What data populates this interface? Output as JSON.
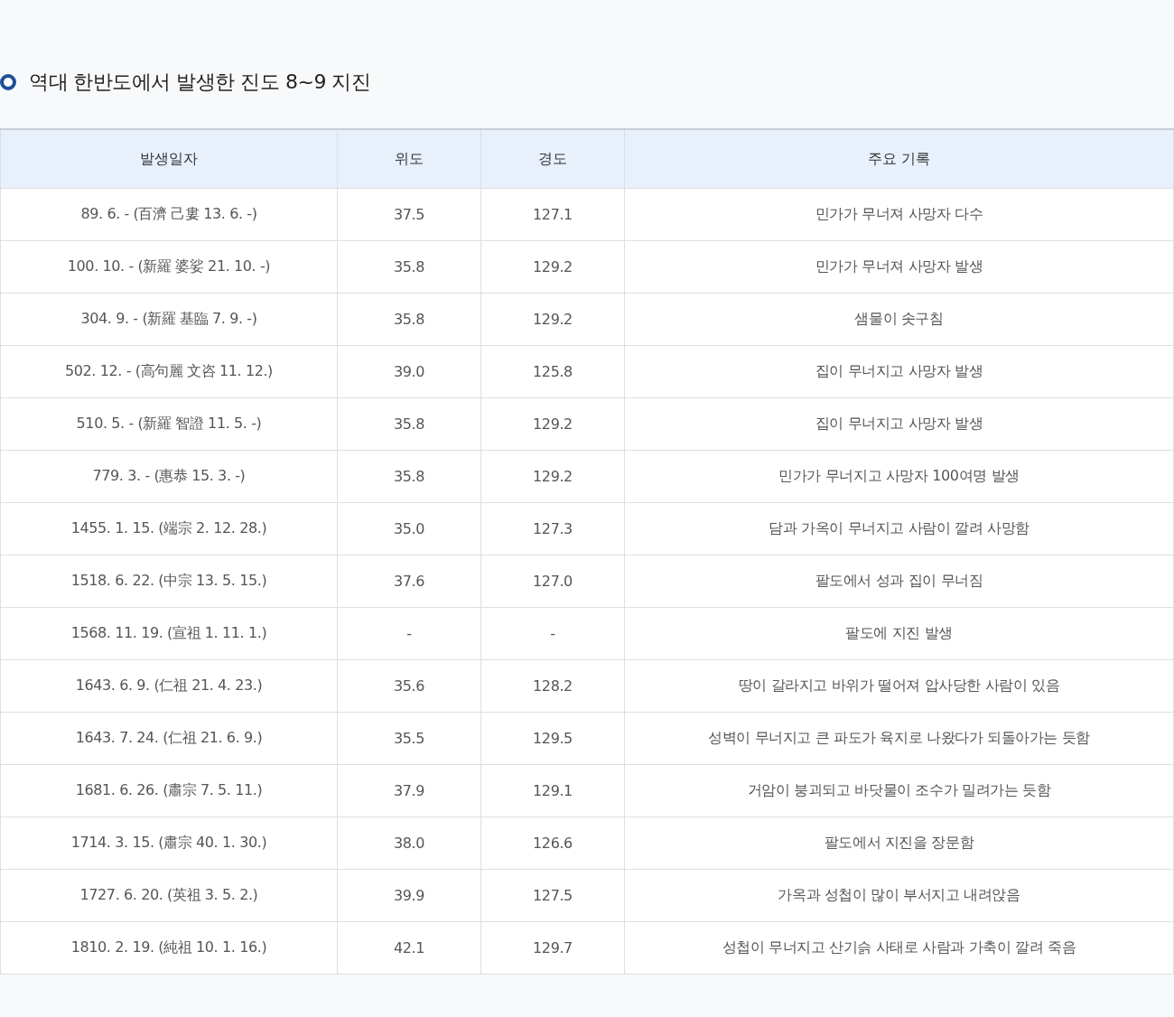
{
  "title": "역대 한반도에서 발생한 진도 8~9 지진",
  "table": {
    "columns": [
      "발생일자",
      "위도",
      "경도",
      "주요 기록"
    ],
    "rows": [
      [
        "89. 6. - (百濟 己婁 13. 6. -)",
        "37.5",
        "127.1",
        "민가가 무너져 사망자 다수"
      ],
      [
        "100. 10. - (新羅 婆娑 21. 10. -)",
        "35.8",
        "129.2",
        "민가가 무너져 사망자 발생"
      ],
      [
        "304. 9. - (新羅 基臨 7. 9. -)",
        "35.8",
        "129.2",
        "샘물이 솟구침"
      ],
      [
        "502. 12. - (高句麗 文咨 11. 12.)",
        "39.0",
        "125.8",
        "집이 무너지고 사망자 발생"
      ],
      [
        "510. 5. - (新羅 智證 11. 5. -)",
        "35.8",
        "129.2",
        "집이 무너지고 사망자 발생"
      ],
      [
        "779. 3. - (惠恭 15. 3. -)",
        "35.8",
        "129.2",
        "민가가 무너지고 사망자 100여명 발생"
      ],
      [
        "1455. 1. 15. (端宗 2. 12. 28.)",
        "35.0",
        "127.3",
        "담과 가옥이 무너지고 사람이 깔려 사망함"
      ],
      [
        "1518. 6. 22. (中宗 13. 5. 15.)",
        "37.6",
        "127.0",
        "팔도에서 성과 집이 무너짐"
      ],
      [
        "1568. 11. 19. (宣祖 1. 11. 1.)",
        "-",
        "-",
        "팔도에 지진 발생"
      ],
      [
        "1643. 6. 9. (仁祖 21. 4. 23.)",
        "35.6",
        "128.2",
        "땅이 갈라지고 바위가 떨어져 압사당한 사람이 있음"
      ],
      [
        "1643. 7. 24. (仁祖 21. 6. 9.)",
        "35.5",
        "129.5",
        "성벽이 무너지고 큰 파도가 육지로 나왔다가 되돌아가는 듯함"
      ],
      [
        "1681. 6. 26. (肅宗 7. 5. 11.)",
        "37.9",
        "129.1",
        "거암이 붕괴되고 바닷물이 조수가 밀려가는 듯함"
      ],
      [
        "1714. 3. 15. (肅宗 40. 1. 30.)",
        "38.0",
        "126.6",
        "팔도에서 지진을 장문함"
      ],
      [
        "1727. 6. 20. (英祖 3. 5. 2.)",
        "39.9",
        "127.5",
        "가옥과 성첩이 많이 부서지고 내려앉음"
      ],
      [
        "1810. 2. 19. (純祖 10. 1. 16.)",
        "42.1",
        "129.7",
        "성첩이 무너지고 산기슭 사태로 사람과 가축이 깔려 죽음"
      ]
    ]
  }
}
